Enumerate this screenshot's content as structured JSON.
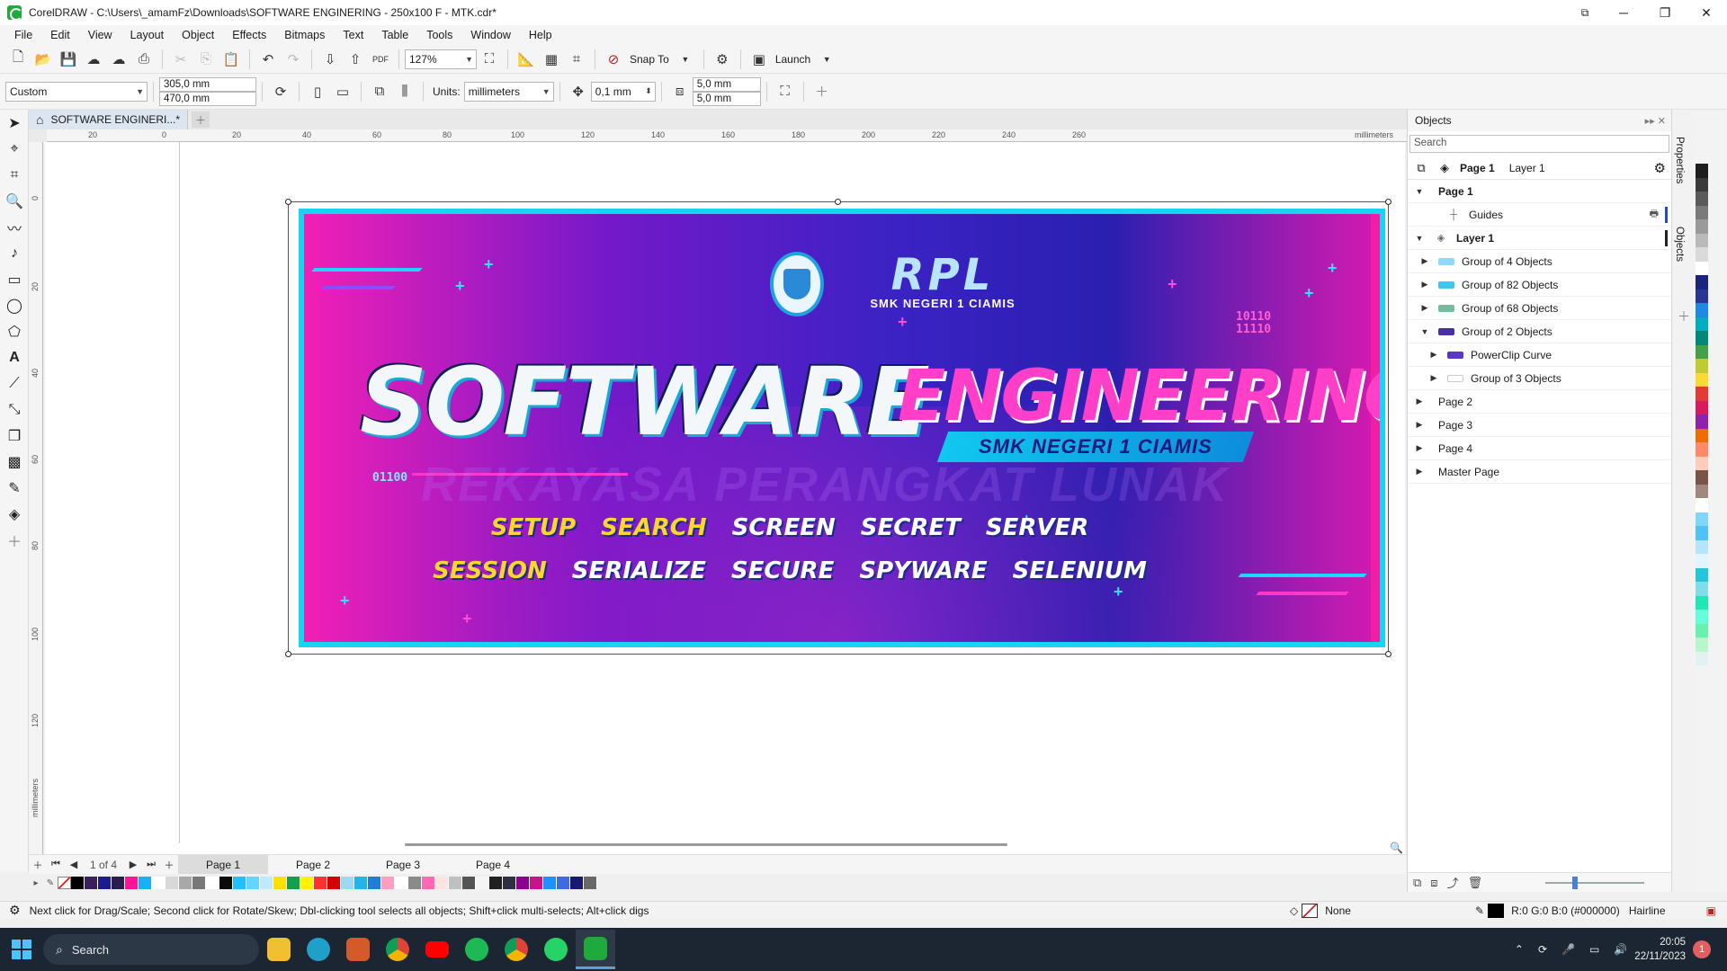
{
  "window": {
    "title": "CorelDRAW - C:\\Users\\_amamFz\\Downloads\\SOFTWARE ENGINERING - 250x100 F - MTK.cdr*",
    "minimize": "─",
    "maximize": "❐",
    "close": "✕"
  },
  "menu": [
    "File",
    "Edit",
    "View",
    "Layout",
    "Object",
    "Effects",
    "Bitmaps",
    "Text",
    "Table",
    "Tools",
    "Window",
    "Help"
  ],
  "toolbar": {
    "zoom": "127%",
    "snap_to": "Snap To",
    "launch": "Launch"
  },
  "propertybar": {
    "preset": "Custom",
    "width": "305,0 mm",
    "height": "470,0 mm",
    "units_label": "Units:",
    "units": "millimeters",
    "nudge": "0,1 mm",
    "dup_x": "5,0 mm",
    "dup_y": "5,0 mm"
  },
  "document_tab": "SOFTWARE ENGINERI...*",
  "ruler": {
    "unit": "millimeters",
    "h_ticks": [
      "20",
      "0",
      "20",
      "40",
      "60",
      "80",
      "100",
      "120",
      "140",
      "160",
      "180",
      "200",
      "220",
      "240",
      "260"
    ],
    "v_ticks": [
      "0",
      "20",
      "40",
      "60",
      "80",
      "100",
      "120",
      "140"
    ]
  },
  "design": {
    "rpl": "RPL",
    "rpl_sub": "SMK NEGERI 1 CIAMIS",
    "title_white": "SOFTWARE",
    "title_pink": "ENGINEERING",
    "sub_banner": "SMK NEGERI 1 CIAMIS",
    "binary_top": "10110\n11110",
    "binary_left": "01100",
    "ghost_text": "REKAYASA PERANGKAT LUNAK",
    "logos": [
      "SETUP",
      "SEARCH",
      "SCREEN",
      "SECRET",
      "SERVER",
      "SESSION",
      "SERIALIZE",
      "SECURE",
      "SPYWARE",
      "SELENIUM"
    ]
  },
  "objects_docker": {
    "title": "Objects",
    "search_placeholder": "Search",
    "page": "Page 1",
    "layer": "Layer 1",
    "tree": [
      {
        "label": "Page 1",
        "level": 0,
        "toggle": "▼",
        "bold": true
      },
      {
        "label": "Guides",
        "level": 1,
        "toggle": "",
        "bold": false
      },
      {
        "label": "Layer 1",
        "level": 1,
        "toggle": "▼",
        "bold": true
      },
      {
        "label": "Group of 4 Objects",
        "level": 2,
        "toggle": "▶",
        "bold": false
      },
      {
        "label": "Group of 82 Objects",
        "level": 2,
        "toggle": "▶",
        "bold": false
      },
      {
        "label": "Group of 68 Objects",
        "level": 2,
        "toggle": "▶",
        "bold": false
      },
      {
        "label": "Group of 2 Objects",
        "level": 2,
        "toggle": "▼",
        "bold": false
      },
      {
        "label": "PowerClip Curve",
        "level": 3,
        "toggle": "▶",
        "bold": false
      },
      {
        "label": "Group of 3 Objects",
        "level": 3,
        "toggle": "▶",
        "bold": false
      },
      {
        "label": "Page 2",
        "level": 0,
        "toggle": "▶",
        "bold": false
      },
      {
        "label": "Page 3",
        "level": 0,
        "toggle": "▶",
        "bold": false
      },
      {
        "label": "Page 4",
        "level": 0,
        "toggle": "▶",
        "bold": false
      },
      {
        "label": "Master Page",
        "level": 0,
        "toggle": "▶",
        "bold": false
      }
    ]
  },
  "side_tabs": [
    "Properties",
    "Objects"
  ],
  "pages": {
    "count": "1 of 4",
    "tabs": [
      "Page 1",
      "Page 2",
      "Page 3",
      "Page 4"
    ]
  },
  "status": {
    "hint": "Next click for Drag/Scale; Second click for Rotate/Skew; Dbl-clicking tool selects all objects; Shift+click multi-selects; Alt+click digs",
    "fill": "None",
    "outline": "R:0 G:0 B:0 (#000000)",
    "outline_width": "Hairline"
  },
  "taskbar": {
    "search": "Search",
    "time": "20:05",
    "date": "22/11/2023",
    "notifications": "1"
  },
  "palette_colors": [
    "#000000",
    "#3a1f5c",
    "#1b1b8f",
    "#2b1d4d",
    "#ff1493",
    "#1cb0f0",
    "#ffffff",
    "#d8d8d8",
    "#a8a8a8",
    "#787878",
    "#ffffff",
    "#0a0a0a",
    "#1ec0ff",
    "#63d6ff",
    "#bfe9ff",
    "#ffe000",
    "#12a04a",
    "#fff200",
    "#ff3030",
    "#d40000",
    "#9fd9f0",
    "#25b4e8",
    "#1f7fd6",
    "#ff9ec0",
    "#ffffff",
    "#8a8a8a",
    "#ff69b4",
    "#ffe4e1",
    "#c0c0c0",
    "#555555",
    "#f5f5f5",
    "#202020",
    "#2f2f44",
    "#8b0088",
    "#c71585",
    "#1e90ff",
    "#4169e1",
    "#191970",
    "#696969"
  ],
  "vpalette_colors": [
    "#1e1e1e",
    "#3a3a3a",
    "#5a5a5a",
    "#7a7a7a",
    "#9a9a9a",
    "#bababa",
    "#dadada",
    "#ffffff",
    "#1a237e",
    "#283593",
    "#1e88e5",
    "#00acc1",
    "#00897b",
    "#43a047",
    "#c0ca33",
    "#fdd835",
    "#e53935",
    "#d81b60",
    "#8e24aa",
    "#ef6c00",
    "#ff8a65",
    "#ffccbc",
    "#795548",
    "#a1887f",
    "#ffffff",
    "#81d4fa",
    "#4fc3f7",
    "#b3e5fc",
    "#e1f5fe",
    "#26c6da",
    "#80deea",
    "#1de9b6",
    "#64ffda",
    "#69f0ae",
    "#b9f6ca",
    "#e0f2f1"
  ]
}
